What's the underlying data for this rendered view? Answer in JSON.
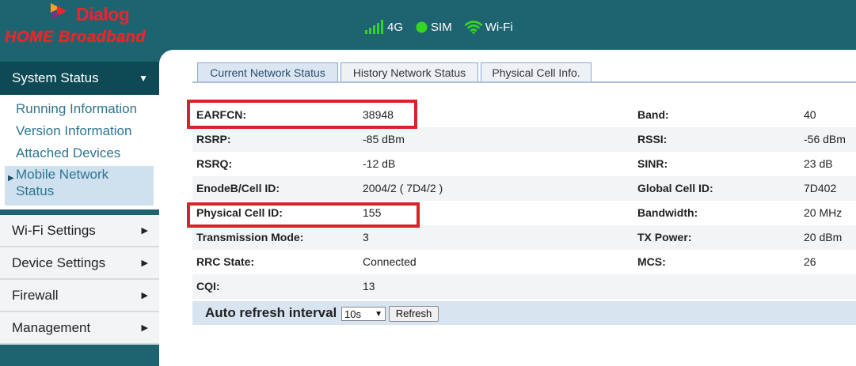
{
  "brand": {
    "name": "Dialog",
    "product": "HOME Broadband"
  },
  "status_bar": {
    "network": {
      "label": "4G",
      "icon": "signal-bars-icon"
    },
    "sim": {
      "label": "SIM",
      "icon": "sim-status-dot-icon"
    },
    "wifi": {
      "label": "Wi-Fi",
      "icon": "wifi-icon"
    },
    "colors": {
      "icon_active": "#36d51f",
      "text": "#ffffff"
    }
  },
  "sidebar": {
    "system_status": {
      "label": "System Status",
      "icon": "triangle-down-icon"
    },
    "sub_items": [
      {
        "label": "Running Information"
      },
      {
        "label": "Version Information"
      },
      {
        "label": "Attached Devices"
      },
      {
        "label": "Mobile Network Status",
        "line1": "Mobile Network",
        "line2": "Status",
        "selected": true
      }
    ],
    "menu": [
      {
        "label": "Wi-Fi Settings",
        "icon": "triangle-right-icon"
      },
      {
        "label": "Device Settings",
        "icon": "triangle-right-icon"
      },
      {
        "label": "Firewall",
        "icon": "triangle-right-icon"
      },
      {
        "label": "Management",
        "icon": "triangle-right-icon"
      }
    ]
  },
  "tabs": [
    {
      "label": "Current Network Status",
      "active": true
    },
    {
      "label": "History Network Status",
      "active": false
    },
    {
      "label": "Physical Cell Info.",
      "active": false
    }
  ],
  "network_status": {
    "rows": [
      {
        "label": "EARFCN:",
        "value": "38948",
        "label2": "Band:",
        "value2": "40"
      },
      {
        "label": "RSRP:",
        "value": "-85 dBm",
        "label2": "RSSI:",
        "value2": "-56 dBm"
      },
      {
        "label": "RSRQ:",
        "value": "-12 dB",
        "label2": "SINR:",
        "value2": "23 dB"
      },
      {
        "label": "EnodeB/Cell ID:",
        "value": "2004/2 ( 7D4/2 )",
        "label2": "Global Cell ID:",
        "value2": "7D402"
      },
      {
        "label": "Physical Cell ID:",
        "value": "155",
        "label2": "Bandwidth:",
        "value2": "20 MHz"
      },
      {
        "label": "Transmission Mode:",
        "value": "3",
        "label2": "TX Power:",
        "value2": "20 dBm"
      },
      {
        "label": "RRC State:",
        "value": "Connected",
        "label2": "MCS:",
        "value2": "26"
      },
      {
        "label": "CQI:",
        "value": "13",
        "label2": "",
        "value2": ""
      }
    ],
    "highlight_color": "#d9232a"
  },
  "refresh": {
    "label": "Auto refresh interval",
    "interval_value": "10s",
    "button_label": "Refresh"
  },
  "colors": {
    "header_bg": "#1d6470",
    "brand_red": "#e8262b",
    "selected_bg": "#cfe0ef"
  }
}
